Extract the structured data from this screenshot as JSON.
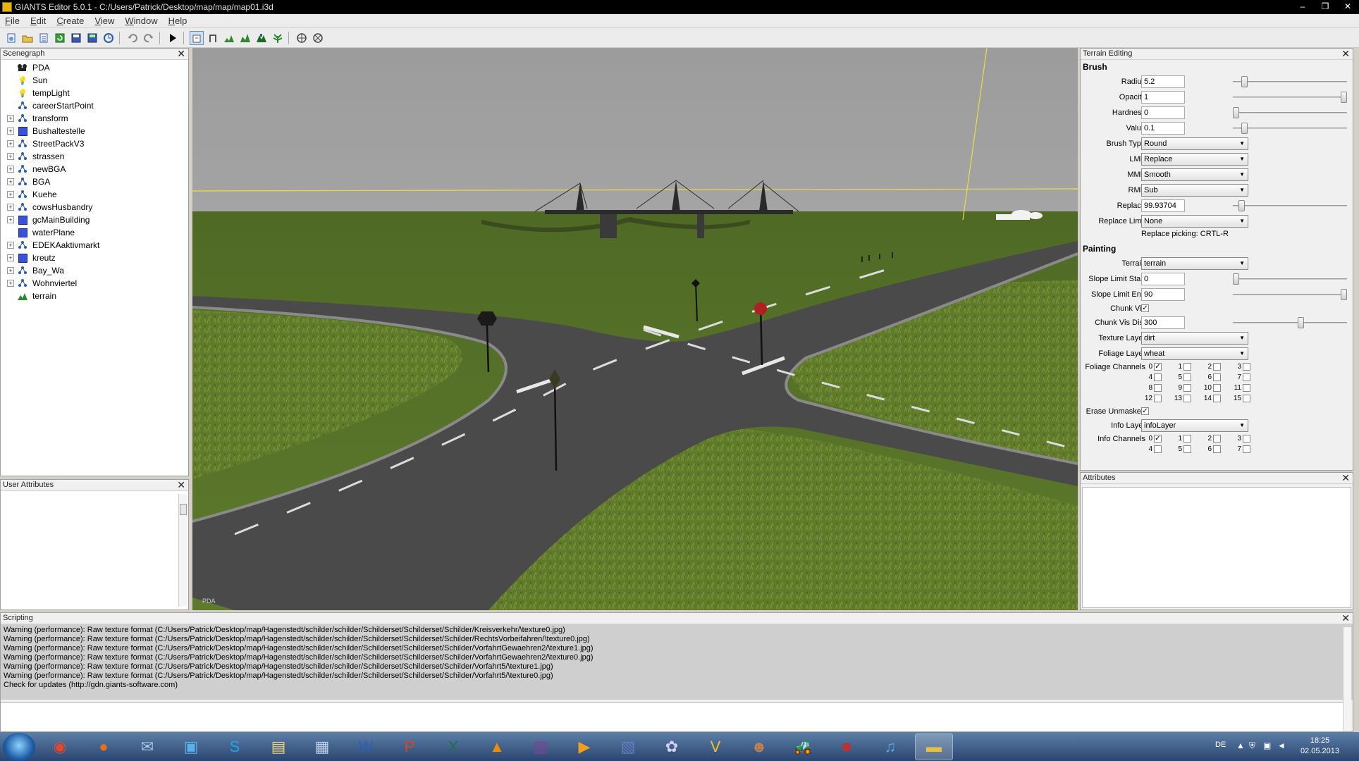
{
  "window": {
    "title": "GIANTS Editor 5.0.1 - C:/Users/Patrick/Desktop/map/map/map01.i3d",
    "controls": [
      "–",
      "❐",
      "✕"
    ]
  },
  "menu": [
    "File",
    "Edit",
    "Create",
    "View",
    "Window",
    "Help"
  ],
  "toolbar": {
    "icons": [
      "new-icon",
      "open-icon",
      "import-icon",
      "reload-icon",
      "save-icon",
      "save-all-icon",
      "export-icon",
      "undo-icon",
      "redo-icon",
      "play-icon",
      "select-mode-icon",
      "move-mode-icon",
      "terrain-sculpt-icon",
      "terrain-paint-icon",
      "terrain-smooth-icon",
      "foliage-paint-icon",
      "grid-icon",
      "snap-icon"
    ]
  },
  "scenegraph": {
    "title": "Scenegraph",
    "close": "✕",
    "items": [
      {
        "label": "PDA",
        "icon": "camera-icon",
        "expandable": false
      },
      {
        "label": "Sun",
        "icon": "light-icon",
        "expandable": false
      },
      {
        "label": "tempLight",
        "icon": "light-icon",
        "expandable": false
      },
      {
        "label": "careerStartPoint",
        "icon": "transform-icon",
        "expandable": false
      },
      {
        "label": "transform",
        "icon": "transform-icon",
        "expandable": true
      },
      {
        "label": "Bushaltestelle",
        "icon": "shape-icon",
        "expandable": true
      },
      {
        "label": "StreetPackV3",
        "icon": "transform-icon",
        "expandable": true
      },
      {
        "label": "strassen",
        "icon": "transform-icon",
        "expandable": true
      },
      {
        "label": "newBGA",
        "icon": "transform-icon",
        "expandable": true
      },
      {
        "label": "BGA",
        "icon": "transform-icon",
        "expandable": true
      },
      {
        "label": "Kuehe",
        "icon": "transform-icon",
        "expandable": true
      },
      {
        "label": "cowsHusbandry",
        "icon": "transform-icon",
        "expandable": true
      },
      {
        "label": "gcMainBuilding",
        "icon": "shape-icon",
        "expandable": true
      },
      {
        "label": "waterPlane",
        "icon": "shape-icon",
        "expandable": false
      },
      {
        "label": "EDEKAaktivmarkt",
        "icon": "transform-icon",
        "expandable": true
      },
      {
        "label": "kreutz",
        "icon": "shape-icon",
        "expandable": true
      },
      {
        "label": "Bay_Wa",
        "icon": "transform-icon",
        "expandable": true
      },
      {
        "label": "Wohnviertel",
        "icon": "transform-icon",
        "expandable": true
      },
      {
        "label": "terrain",
        "icon": "terrain-icon",
        "expandable": false
      }
    ]
  },
  "user_attributes": {
    "title": "User Attributes",
    "close": "✕"
  },
  "viewport": {
    "camera_label": "PDA"
  },
  "terrain_editing": {
    "title": "Terrain Editing",
    "close": "✕",
    "brush_section": "Brush",
    "radius": {
      "label": "Radius",
      "value": "5.2",
      "slider": 0.08
    },
    "opacity": {
      "label": "Opacity",
      "value": "1",
      "slider": 1.0
    },
    "hardness": {
      "label": "Hardness",
      "value": "0",
      "slider": 0.0
    },
    "value": {
      "label": "Value",
      "value": "0.1",
      "slider": 0.08
    },
    "brush_type": {
      "label": "Brush Type",
      "value": "Round"
    },
    "lmb": {
      "label": "LMB",
      "value": "Replace"
    },
    "mmb": {
      "label": "MMB",
      "value": "Smooth"
    },
    "rmb": {
      "label": "RMB",
      "value": "Sub"
    },
    "replace": {
      "label": "Replace",
      "value": "99.93704",
      "slider": 0.05
    },
    "replace_limit": {
      "label": "Replace Limit",
      "value": "None"
    },
    "replace_picking": "Replace picking: CRTL-R",
    "painting_section": "Painting",
    "terrain": {
      "label": "Terrain",
      "value": "terrain"
    },
    "slope_limit_start": {
      "label": "Slope Limit Start",
      "value": "0",
      "slider": 0.0
    },
    "slope_limit_end": {
      "label": "Slope Limit End",
      "value": "90",
      "slider": 1.0
    },
    "chunk_vis": {
      "label": "Chunk Vis",
      "checked": "✓"
    },
    "chunk_vis_dist": {
      "label": "Chunk Vis Dist",
      "value": "300",
      "slider": 0.6
    },
    "texture_layer": {
      "label": "Texture Layer",
      "value": "dirt"
    },
    "foliage_layer": {
      "label": "Foliage Layer",
      "value": "wheat"
    },
    "foliage_channels": {
      "label": "Foliage Channels",
      "cells": [
        {
          "n": "0",
          "c": "✓"
        },
        {
          "n": "1",
          "c": ""
        },
        {
          "n": "2",
          "c": ""
        },
        {
          "n": "3",
          "c": ""
        },
        {
          "n": "4",
          "c": ""
        },
        {
          "n": "5",
          "c": ""
        },
        {
          "n": "6",
          "c": ""
        },
        {
          "n": "7",
          "c": ""
        },
        {
          "n": "8",
          "c": ""
        },
        {
          "n": "9",
          "c": ""
        },
        {
          "n": "10",
          "c": ""
        },
        {
          "n": "11",
          "c": ""
        },
        {
          "n": "12",
          "c": ""
        },
        {
          "n": "13",
          "c": ""
        },
        {
          "n": "14",
          "c": ""
        },
        {
          "n": "15",
          "c": ""
        }
      ]
    },
    "erase_unmasked": {
      "label": "Erase Unmasked",
      "checked": "✓"
    },
    "info_layer": {
      "label": "Info Layer",
      "value": "infoLayer"
    },
    "info_channels": {
      "label": "Info Channels",
      "cells": [
        {
          "n": "0",
          "c": "✓"
        },
        {
          "n": "1",
          "c": ""
        },
        {
          "n": "2",
          "c": ""
        },
        {
          "n": "3",
          "c": ""
        },
        {
          "n": "4",
          "c": ""
        },
        {
          "n": "5",
          "c": ""
        },
        {
          "n": "6",
          "c": ""
        },
        {
          "n": "7",
          "c": ""
        }
      ]
    }
  },
  "attributes": {
    "title": "Attributes",
    "close": "✕"
  },
  "scripting": {
    "title": "Scripting",
    "close": "✕",
    "lines": [
      "Warning (performance): Raw texture format (C:/Users/Patrick/Desktop/map/Hagenstedt/schilder/schilder/Schilderset/Schilderset/Schilder/Kreisverkehr/\\texture0.jpg)",
      "Warning (performance): Raw texture format (C:/Users/Patrick/Desktop/map/Hagenstedt/schilder/schilder/Schilderset/Schilderset/Schilder/RechtsVorbeifahren/\\texture0.jpg)",
      "Warning (performance): Raw texture format (C:/Users/Patrick/Desktop/map/Hagenstedt/schilder/schilder/Schilderset/Schilderset/Schilder/VorfahrtGewaehren2/\\texture1.jpg)",
      "Warning (performance): Raw texture format (C:/Users/Patrick/Desktop/map/Hagenstedt/schilder/schilder/Schilderset/Schilderset/Schilder/VorfahrtGewaehren2/\\texture0.jpg)",
      "Warning (performance): Raw texture format (C:/Users/Patrick/Desktop/map/Hagenstedt/schilder/schilder/Schilderset/Schilderset/Schilder/Vorfahrt5/\\texture1.jpg)",
      "Warning (performance): Raw texture format (C:/Users/Patrick/Desktop/map/Hagenstedt/schilder/schilder/Schilderset/Schilderset/Schilder/Vorfahrt5/\\texture0.jpg)",
      "Check for updates (http://gdn.giants-software.com)"
    ]
  },
  "taskbar": {
    "apps": [
      {
        "name": "chrome-icon",
        "glyph": "◉",
        "color": "#e8452c"
      },
      {
        "name": "firefox-icon",
        "glyph": "●",
        "color": "#e8701c"
      },
      {
        "name": "thunderbird-icon",
        "glyph": "✉",
        "color": "#a8c8e8"
      },
      {
        "name": "media-center-icon",
        "glyph": "▣",
        "color": "#5ab0e8"
      },
      {
        "name": "skype-icon",
        "glyph": "S",
        "color": "#1ea8e8"
      },
      {
        "name": "explorer-icon",
        "glyph": "▤",
        "color": "#f0d070"
      },
      {
        "name": "remote-desktop-icon",
        "glyph": "▦",
        "color": "#c0d0e8"
      },
      {
        "name": "word-icon",
        "glyph": "W",
        "color": "#2b5fb5"
      },
      {
        "name": "powerpoint-icon",
        "glyph": "P",
        "color": "#d24726"
      },
      {
        "name": "excel-icon",
        "glyph": "X",
        "color": "#1e7145"
      },
      {
        "name": "vlc-icon",
        "glyph": "▲",
        "color": "#f08c00"
      },
      {
        "name": "winrar-icon",
        "glyph": "▥",
        "color": "#8a3a9a"
      },
      {
        "name": "media-player-icon",
        "glyph": "▶",
        "color": "#f0a020"
      },
      {
        "name": "monitor-tool-icon",
        "glyph": "▧",
        "color": "#6080c0"
      },
      {
        "name": "network-tool-icon",
        "glyph": "✿",
        "color": "#d0d0f0"
      },
      {
        "name": "vectorworks-icon",
        "glyph": "V",
        "color": "#f0c030"
      },
      {
        "name": "game-icon",
        "glyph": "☻",
        "color": "#c08050"
      },
      {
        "name": "farming-sim-icon",
        "glyph": "🚜",
        "color": "#404040"
      },
      {
        "name": "farming-sim-2-icon",
        "glyph": "■",
        "color": "#c03030"
      },
      {
        "name": "itunes-icon",
        "glyph": "♫",
        "color": "#58a8e8"
      },
      {
        "name": "giants-editor-icon",
        "glyph": "▬",
        "color": "#e8c040"
      }
    ],
    "active_index": 20,
    "language": "DE",
    "time": "18:25",
    "date": "02.05.2013"
  }
}
